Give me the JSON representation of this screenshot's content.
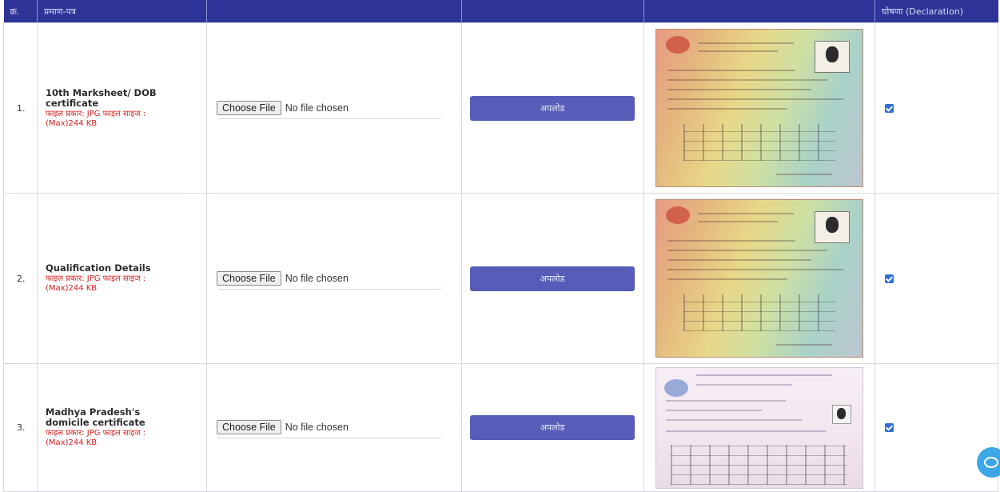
{
  "table": {
    "headers": [
      "क्र.",
      "प्रमाण-पत्र",
      "",
      "",
      "",
      "घोषणा (Declaration)"
    ],
    "file_input": {
      "button_label": "Choose File",
      "status_text": "No file chosen"
    },
    "upload_button_label": "अपलोड",
    "rows": [
      {
        "serial": "1.",
        "document": "10th Marksheet/ DOB certificate",
        "hint": "फाइल प्रकार: JPG फाइल साइज : (Max)244 KB",
        "declaration_checked": true
      },
      {
        "serial": "2.",
        "document": "Qualification Details",
        "hint": "फाइल प्रकार: JPG फाइल साइज : (Max)244 KB",
        "declaration_checked": true
      },
      {
        "serial": "3.",
        "document": "Madhya Pradesh's domicile certificate",
        "hint": "फाइल प्रकार: JPG फाइल साइज : (Max)244 KB",
        "declaration_checked": true
      }
    ]
  },
  "colors": {
    "header_bg": "#2e3497",
    "button_bg": "#565cb8",
    "hint_text": "#d62020",
    "checkbox": "#2c6fd6",
    "chat_widget": "#3da6e6"
  },
  "icons": [
    "checkbox-checked-icon",
    "chat-icon"
  ]
}
